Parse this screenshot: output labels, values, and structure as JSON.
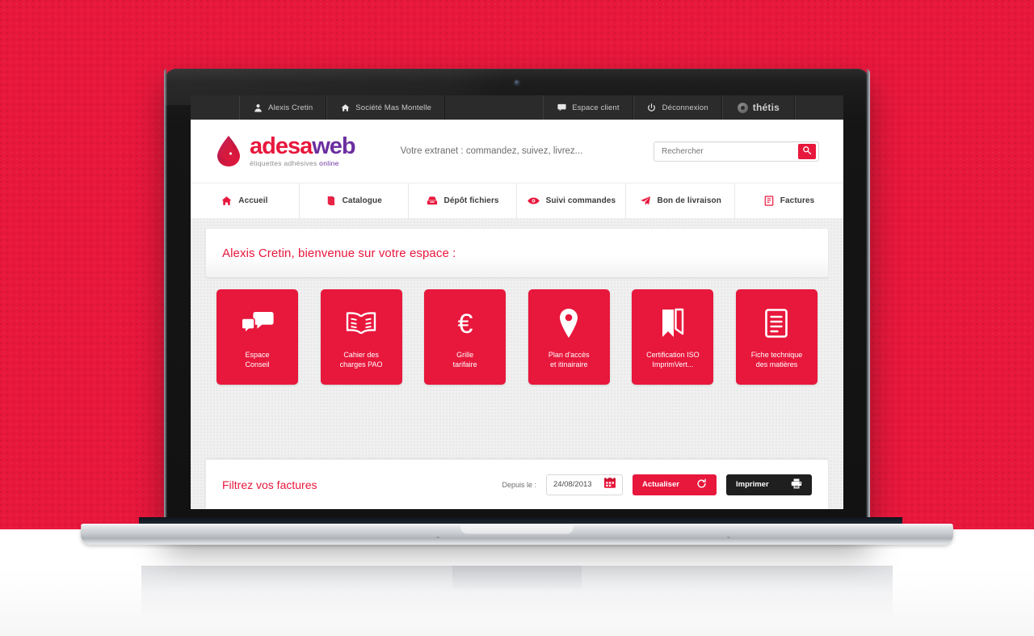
{
  "theme": {
    "accent": "#e8173c",
    "purple": "#6b2fa0",
    "dark_bar": "#2b2b2b",
    "dark_button": "#1f1f1f"
  },
  "topbar": {
    "user": {
      "label": "Alexis Cretin",
      "icon": "user-icon"
    },
    "company": {
      "label": "Société Mas Montelle",
      "icon": "home-icon"
    },
    "client_area": {
      "label": "Espace client",
      "icon": "screen-icon"
    },
    "logout": {
      "label": "Déconnexion",
      "icon": "power-icon"
    },
    "vendor": {
      "label": "thétis",
      "icon": "thetis-logo-icon"
    }
  },
  "header": {
    "logo": {
      "main_red": "adesa",
      "main_purple": "web",
      "sub_grey": "étiquettes adhésives ",
      "sub_purple": "online",
      "icon": "droplet-icon"
    },
    "tagline": "Votre extranet : commandez, suivez, livrez...",
    "search": {
      "placeholder": "Rechercher",
      "value": "",
      "button_icon": "search-icon"
    }
  },
  "nav": {
    "items": [
      {
        "label": "Accueil",
        "icon": "home-icon"
      },
      {
        "label": "Catalogue",
        "icon": "book-icon"
      },
      {
        "label": "Dépôt fichiers",
        "icon": "upload-box-icon"
      },
      {
        "label": "Suivi commandes",
        "icon": "eye-icon"
      },
      {
        "label": "Bon de livraison",
        "icon": "paper-plane-icon"
      },
      {
        "label": "Factures",
        "icon": "invoice-icon"
      }
    ]
  },
  "welcome": {
    "text": "Alexis Cretin, bienvenue sur votre espace :"
  },
  "tiles": [
    {
      "label": "Espace\nConseil",
      "line1": "Espace",
      "line2": "Conseil",
      "icon": "chat-bubbles-icon"
    },
    {
      "label": "Cahier des charges PAO",
      "line1": "Cahier des",
      "line2": "charges PAO",
      "icon": "open-book-icon"
    },
    {
      "label": "Grille tarifaire",
      "line1": "Grille",
      "line2": "tarifaire",
      "icon": "euro-icon"
    },
    {
      "label": "Plan d'accès et itinairaire",
      "line1": "Plan d'accès",
      "line2": "et itinairaire",
      "icon": "map-pin-icon"
    },
    {
      "label": "Certification ISO ImprimVert...",
      "line1": "Certification ISO",
      "line2": "ImprimVert...",
      "icon": "bookmark-ribbon-icon"
    },
    {
      "label": "Fiche technique des matières",
      "line1": "Fiche technique",
      "line2": "des matières",
      "icon": "document-lines-icon"
    }
  ],
  "filter": {
    "title": "Filtrez vos factures",
    "date_label": "Depuis le :",
    "date_value": "24/08/2013",
    "date_icon": "calendar-icon",
    "refresh_button": {
      "label": "Actualiser",
      "icon": "refresh-icon"
    },
    "print_button": {
      "label": "Imprimer",
      "icon": "printer-icon"
    }
  }
}
